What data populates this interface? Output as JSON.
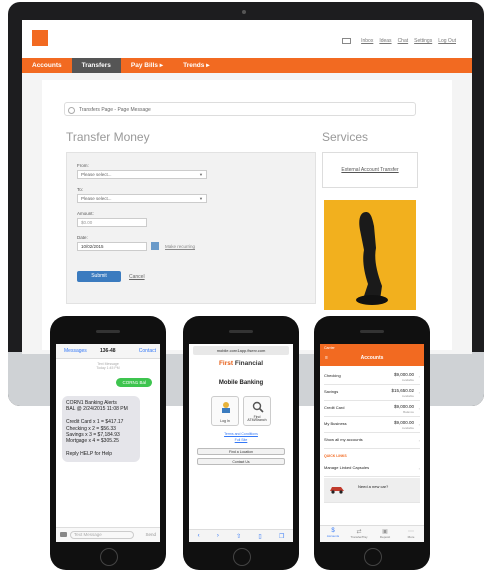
{
  "desktop": {
    "toplinks": [
      "Inbox",
      "Ideas",
      "Chat",
      "Settings",
      "Log Out"
    ],
    "nav": [
      "Accounts",
      "Transfers",
      "Pay Bills ▸",
      "Trends ▸"
    ],
    "message_bar": "Transfers Page - Page Message",
    "transfer_heading": "Transfer Money",
    "services_heading": "Services",
    "form": {
      "from_label": "From:",
      "from_value": "Please select...",
      "to_label": "To:",
      "to_value": "Please select...",
      "amount_label": "Amount:",
      "amount_placeholder": "$0.00",
      "date_label": "Date:",
      "date_value": "10/02/2015",
      "schedule_link": "Make recurring",
      "submit_label": "Submit",
      "cancel_label": "Cancel"
    },
    "service_link": "External Account Transfer",
    "ad_image": "telephone-handset on yellow background",
    "accent_color": "#f26a21"
  },
  "phone_sms": {
    "back": "Messages",
    "title": "136-48",
    "contact": "Contact",
    "meta_line1": "Text Message",
    "meta_line2": "Today 1:45 PM",
    "sent": "CORN1 Bal",
    "reply": "CORN1 Banking Alerts\nBAL @ 2/24/2015 11:08 PM\n\nCredit Card x 1 = $417.17\nChecking x 2 = $56.33\nSavings x 3 = $7,184.93\nMortgage x 4 = $305.25\n\nReply HELP for Help",
    "compose_placeholder": "Text Message",
    "send": "Send"
  },
  "phone_web": {
    "url": "mobile.corn1app.fiserv.com",
    "logo_first": "First",
    "logo_second": "Financial",
    "title": "Mobile Banking",
    "tile_login": "Log In",
    "tile_atm": "Find\nATM/Branch",
    "link1": "Terms and Conditions",
    "link2": "Full Site",
    "btn1": "Find a Location",
    "btn2": "Contact Us"
  },
  "phone_app": {
    "status": "Carrier",
    "title": "Accounts",
    "accounts": [
      {
        "name": "Checking",
        "amount": "$9,000.00",
        "sub": "Available"
      },
      {
        "name": "Savings",
        "amount": "$15,650.02",
        "sub": "Available"
      },
      {
        "name": "Credit Card",
        "amount": "$9,000.00",
        "sub": "Balance"
      },
      {
        "name": "My Business",
        "amount": "$9,000.00",
        "sub": "Available"
      }
    ],
    "show_all": "Show all my accounts",
    "section": "QUICK LINKS",
    "quick_link": "Manage Linked Capsules",
    "promo": "Need a new car?",
    "toolbar": [
      "Accounts",
      "Transfer/Pay",
      "Deposit",
      "More"
    ]
  }
}
